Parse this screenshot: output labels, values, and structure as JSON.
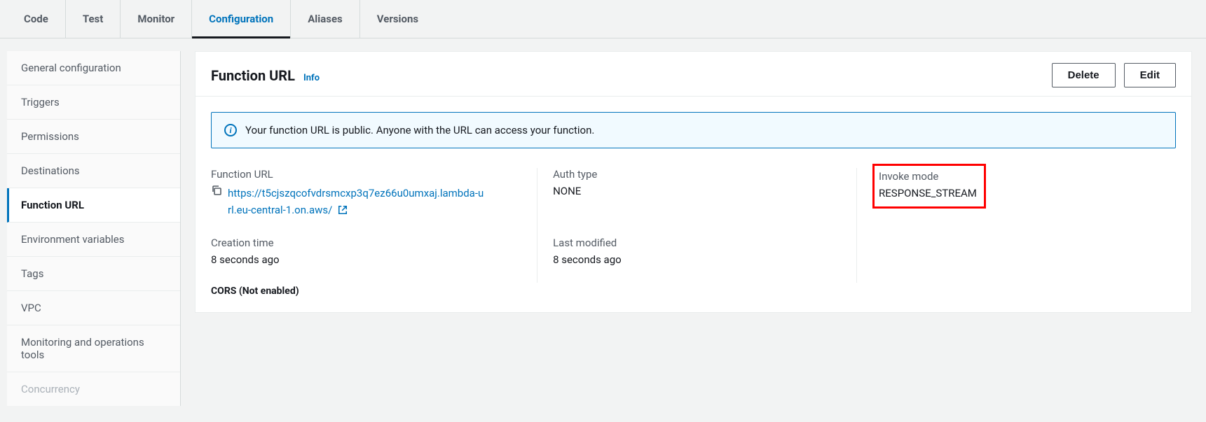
{
  "tabs": {
    "items": [
      {
        "label": "Code"
      },
      {
        "label": "Test"
      },
      {
        "label": "Monitor"
      },
      {
        "label": "Configuration",
        "active": true
      },
      {
        "label": "Aliases"
      },
      {
        "label": "Versions"
      }
    ]
  },
  "sidebar": {
    "items": [
      {
        "label": "General configuration"
      },
      {
        "label": "Triggers"
      },
      {
        "label": "Permissions"
      },
      {
        "label": "Destinations"
      },
      {
        "label": "Function URL",
        "active": true
      },
      {
        "label": "Environment variables"
      },
      {
        "label": "Tags"
      },
      {
        "label": "VPC"
      },
      {
        "label": "Monitoring and operations tools"
      },
      {
        "label": "Concurrency"
      }
    ]
  },
  "panel": {
    "title": "Function URL",
    "info_link": "Info",
    "actions": {
      "delete": "Delete",
      "edit": "Edit"
    },
    "alert": "Your function URL is public. Anyone with the URL can access your function.",
    "fields": {
      "function_url_label": "Function URL",
      "function_url_value": "https://t5cjszqcofvdrsmcxp3q7ez66u0umxaj.lambda-url.eu-central-1.on.aws/",
      "auth_type_label": "Auth type",
      "auth_type_value": "NONE",
      "invoke_mode_label": "Invoke mode",
      "invoke_mode_value": "RESPONSE_STREAM",
      "creation_time_label": "Creation time",
      "creation_time_value": "8 seconds ago",
      "last_modified_label": "Last modified",
      "last_modified_value": "8 seconds ago"
    },
    "cors_label": "CORS (Not enabled)"
  }
}
